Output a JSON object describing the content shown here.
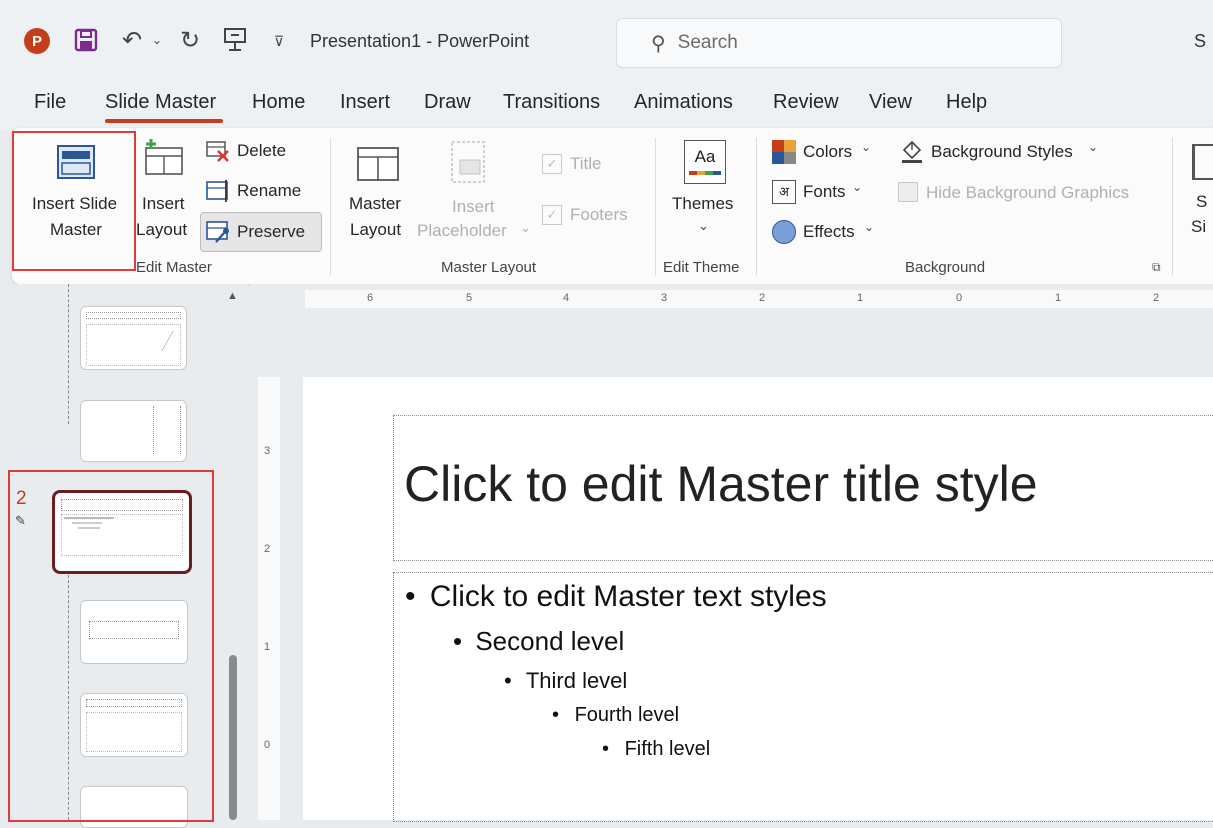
{
  "app": {
    "title": "Presentation1  -  PowerPoint",
    "user_initial": "S"
  },
  "search": {
    "placeholder": "Search"
  },
  "tabs": [
    "File",
    "Slide Master",
    "Home",
    "Insert",
    "Draw",
    "Transitions",
    "Animations",
    "Review",
    "View",
    "Help"
  ],
  "active_tab": "Slide Master",
  "ribbon": {
    "edit_master": {
      "label": "Edit Master",
      "insert_slide_master": [
        "Insert Slide",
        "Master"
      ],
      "insert_layout": [
        "Insert",
        "Layout"
      ],
      "delete": "Delete",
      "rename": "Rename",
      "preserve": "Preserve"
    },
    "master_layout": {
      "label": "Master Layout",
      "master_layout_btn": [
        "Master",
        "Layout"
      ],
      "insert_placeholder": [
        "Insert",
        "Placeholder"
      ],
      "title_check": "Title",
      "footers_check": "Footers"
    },
    "edit_theme": {
      "label": "Edit Theme",
      "themes": "Themes",
      "themes_glyph": "Aa"
    },
    "background": {
      "label": "Background",
      "colors": "Colors",
      "fonts": "Fonts",
      "fonts_glyph": "अ",
      "effects": "Effects",
      "background_styles": "Background Styles",
      "hide_background_graphics": "Hide Background Graphics"
    },
    "overflow": [
      "S",
      "Si"
    ]
  },
  "thumbnails": {
    "selected_number": "2"
  },
  "ruler": {
    "horizontal": [
      "6",
      "5",
      "4",
      "3",
      "2",
      "1",
      "0",
      "1",
      "2"
    ],
    "vertical": [
      "3",
      "2",
      "1",
      "0"
    ]
  },
  "slide": {
    "title": "Click to edit Master title style",
    "levels": [
      "Click to edit Master text styles",
      "Second level",
      "Third level",
      "Fourth level",
      "Fifth level"
    ]
  },
  "colors": {
    "accent": "#c43e1c",
    "highlight": "#e03a3a"
  }
}
